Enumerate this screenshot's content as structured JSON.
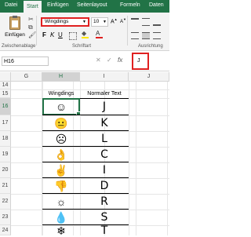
{
  "tabs": [
    "Datei",
    "Start",
    "Einfügen",
    "Seitenlayout",
    "Formeln",
    "Daten"
  ],
  "ribbon": {
    "paste_label": "Einfügen",
    "clipboard_label": "Zwischenablage",
    "font_group_label": "Schriftart",
    "align_group_label": "Ausrichtung",
    "font_name": "Wingdings",
    "font_size": "10",
    "bold": "F",
    "italic": "K",
    "underline": "U"
  },
  "formula_bar": {
    "name_box": "H16",
    "fx": "fx",
    "content": "J"
  },
  "columns": [
    "G",
    "H",
    "I",
    "J"
  ],
  "rows": [
    "14",
    "15",
    "16",
    "17",
    "18",
    "19",
    "20",
    "21",
    "22",
    "23",
    "24"
  ],
  "table": {
    "header_wingdings": "Wingdings",
    "header_text": "Normaler Text",
    "rows": [
      {
        "glyph": "☺",
        "letter": "J"
      },
      {
        "glyph": "😐",
        "letter": "K"
      },
      {
        "glyph": "☹",
        "letter": "L"
      },
      {
        "glyph": "👌",
        "letter": "C"
      },
      {
        "glyph": "✌",
        "letter": "I"
      },
      {
        "glyph": "👎",
        "letter": "D"
      },
      {
        "glyph": "☼",
        "letter": "R"
      },
      {
        "glyph": "💧",
        "letter": "S"
      },
      {
        "glyph": "❄",
        "letter": "T"
      }
    ]
  },
  "colors": {
    "excel_green": "#217346",
    "highlight": "#e02020"
  }
}
